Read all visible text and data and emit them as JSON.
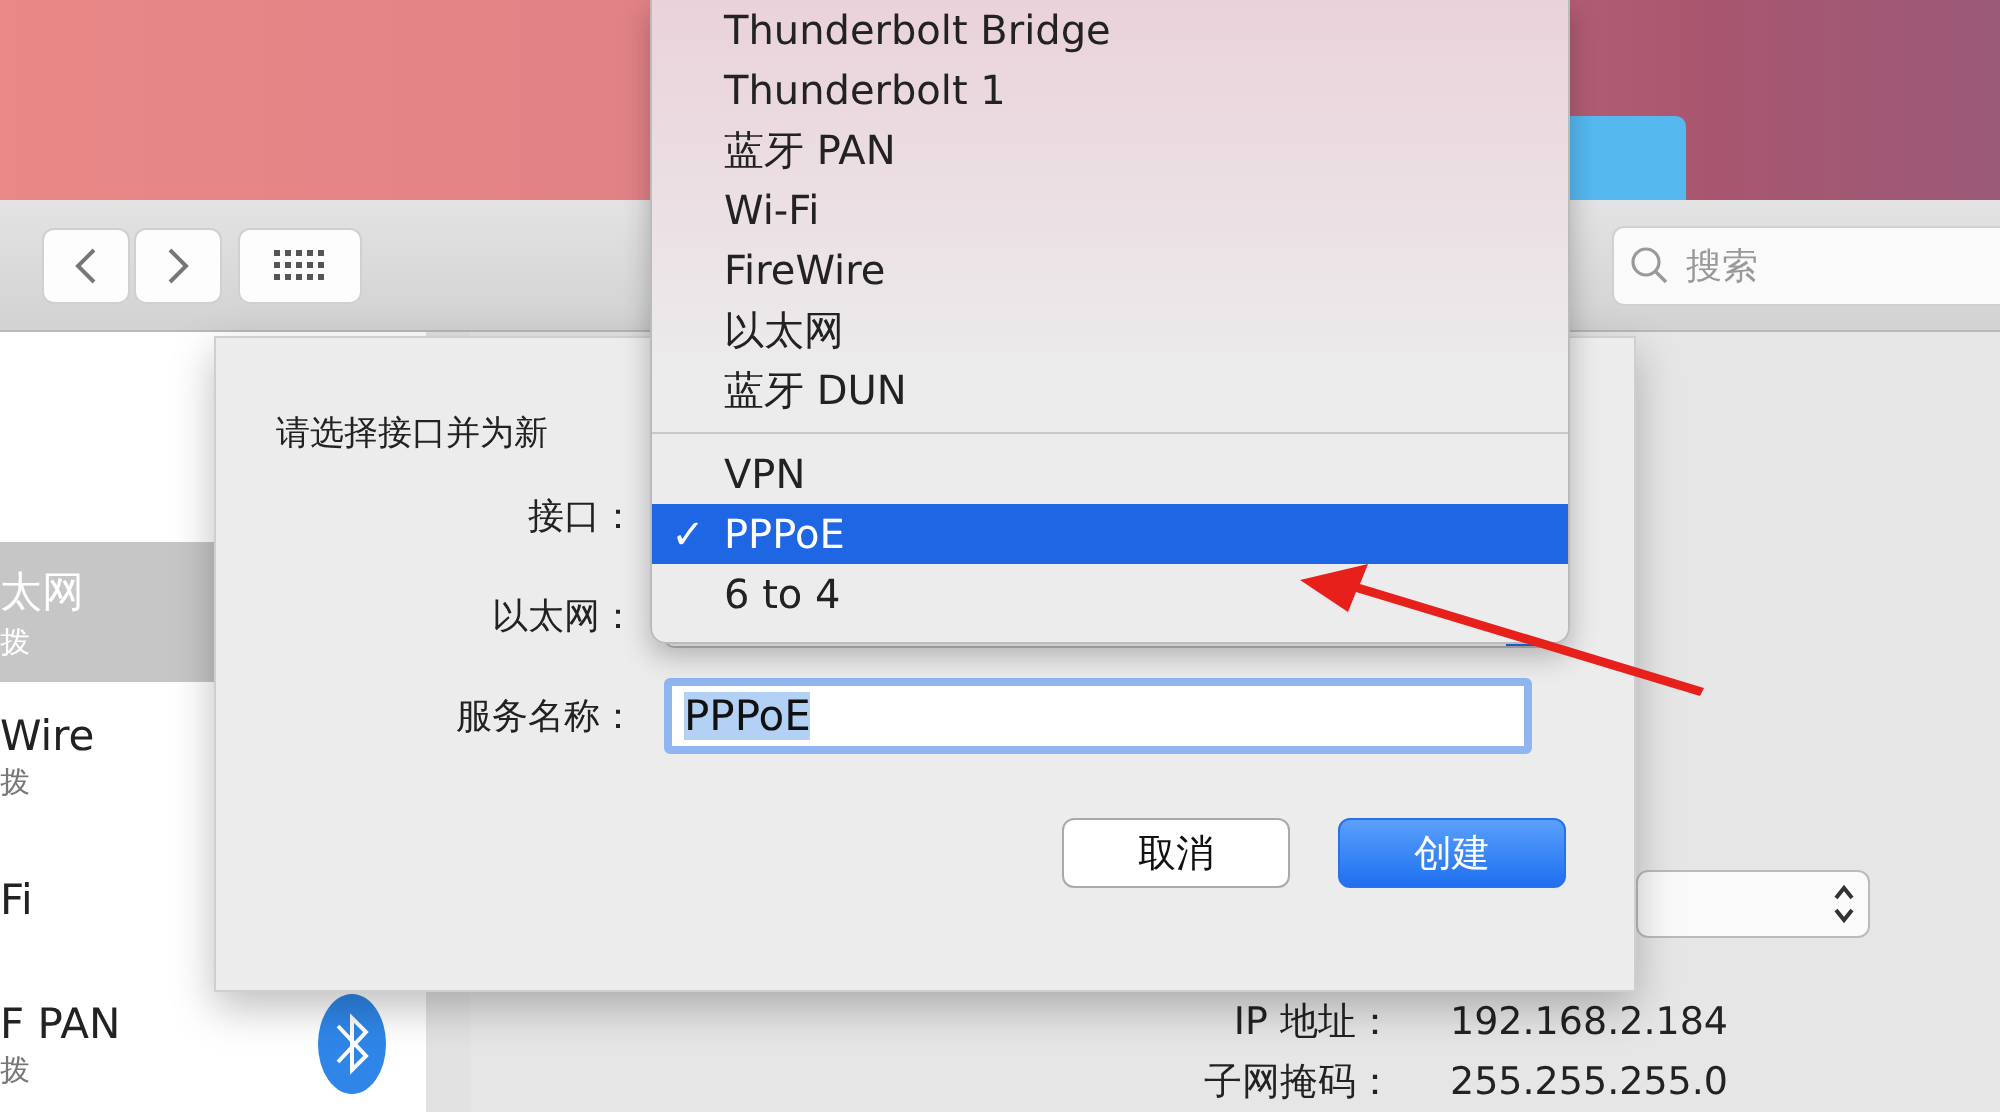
{
  "toolbar": {
    "search": {
      "placeholder": "搜索"
    }
  },
  "sidebar": {
    "items": [
      {
        "name": "太网",
        "status": "拨",
        "selected": true,
        "kind": "plain"
      },
      {
        "name": "Wire",
        "status": "拨",
        "selected": false,
        "kind": "plain"
      },
      {
        "name": "Fi",
        "selected": false,
        "kind": "plain"
      },
      {
        "name": "F PAN",
        "status": "拨",
        "selected": false,
        "kind": "bluetooth"
      }
    ]
  },
  "details": [
    {
      "label": "IP 地址：",
      "value": "192.168.2.184"
    },
    {
      "label": "子网掩码：",
      "value": "255.255.255.0"
    }
  ],
  "dialog": {
    "prompt": "请选择接口并为新",
    "interface_label": "接口：",
    "ethernet_label": "以太网：",
    "service_label": "服务名称：",
    "service_value": "PPPoE",
    "buttons": [
      {
        "label": "取消",
        "kind": "cancel"
      },
      {
        "label": "创建",
        "kind": "default"
      }
    ]
  },
  "menu": {
    "items": [
      {
        "kind": "item",
        "label": "Thunderbolt Bridge",
        "selected": false
      },
      {
        "kind": "item",
        "label": "Thunderbolt 1",
        "selected": false
      },
      {
        "kind": "item",
        "label": "蓝牙 PAN",
        "selected": false
      },
      {
        "kind": "item",
        "label": "Wi-Fi",
        "selected": false
      },
      {
        "kind": "item",
        "label": "FireWire",
        "selected": false
      },
      {
        "kind": "item",
        "label": "以太网",
        "selected": false
      },
      {
        "kind": "item",
        "label": "蓝牙 DUN",
        "selected": false
      },
      {
        "kind": "separator"
      },
      {
        "kind": "item",
        "label": "VPN",
        "selected": false
      },
      {
        "kind": "item",
        "label": "PPPoE",
        "selected": true,
        "check": "✓"
      },
      {
        "kind": "item",
        "label": "6 to 4",
        "selected": false
      }
    ]
  }
}
